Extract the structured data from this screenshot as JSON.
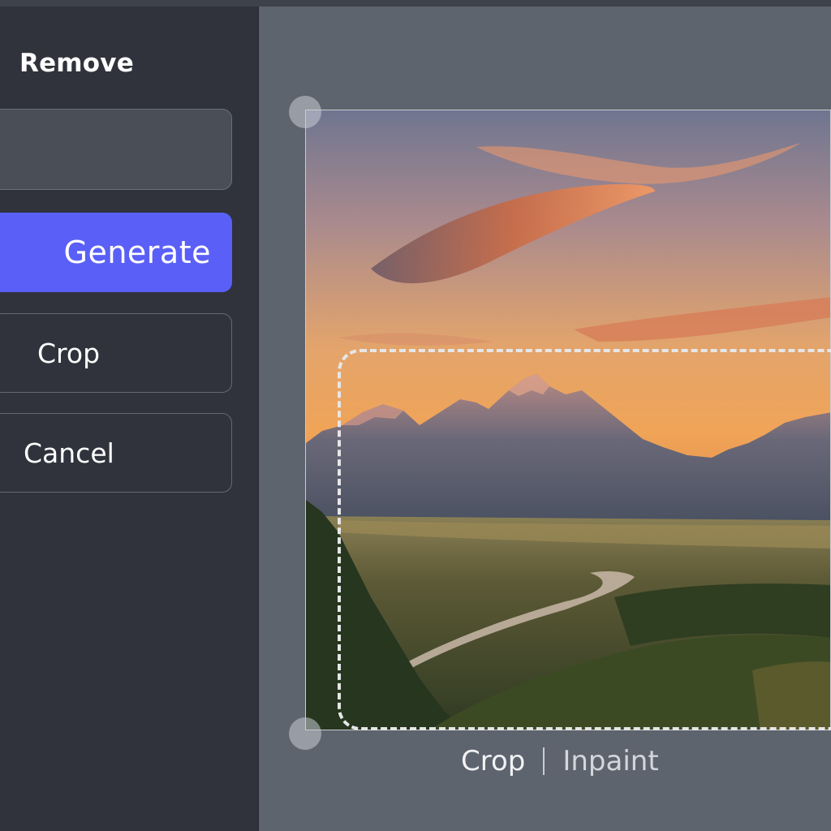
{
  "sidebar": {
    "title": "Remove",
    "prompt": {
      "value": "",
      "placeholder": ""
    },
    "buttons": {
      "generate": "Generate",
      "crop": "Crop",
      "cancel": "Cancel"
    }
  },
  "canvas": {
    "modes": {
      "crop": "Crop",
      "inpaint": "Inpaint"
    }
  },
  "colors": {
    "accent": "#5a5ff7",
    "sidebar_bg": "#30333b",
    "canvas_bg": "#5d646d"
  }
}
